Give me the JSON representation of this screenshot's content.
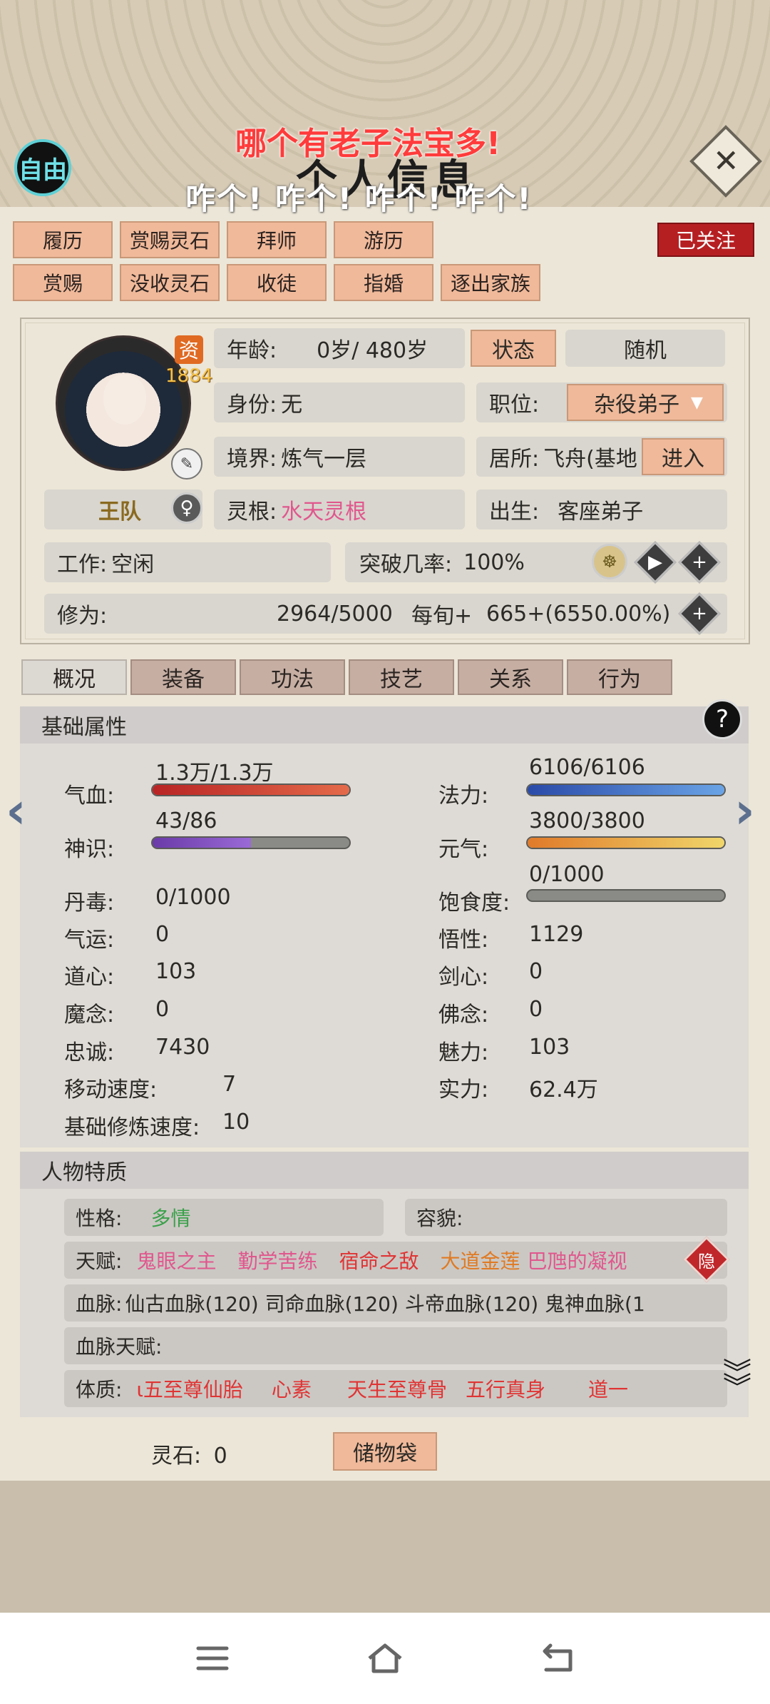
{
  "header": {
    "free_badge": "自由",
    "title": "个人信息",
    "danmaku_top": "哪个有老子法宝多!",
    "danmaku_bottom": "咋个!  咋个!  咋个!  咋个!"
  },
  "follow_button": "已关注",
  "actions": [
    "履历",
    "赏赐灵石",
    "拜师",
    "游历",
    "赏赐",
    "没收灵石",
    "收徒",
    "指婚",
    "逐出家族"
  ],
  "profile": {
    "zi_label": "资",
    "zi_value": "1884",
    "name": "王队",
    "gender_icon": "♀",
    "age_label": "年龄:",
    "age_value": "0岁/ 480岁",
    "status_button": "状态",
    "random_button": "随机",
    "identity_label": "身份:",
    "identity_value": "无",
    "position_label": "职位:",
    "position_value": "杂役弟子",
    "realm_label": "境界:",
    "realm_value": "炼气一层",
    "residence_label": "居所:",
    "residence_value": "飞舟(基地",
    "enter_button": "进入",
    "root_label": "灵根:",
    "root_value": "水天灵根",
    "birth_label": "出生:",
    "birth_value": "客座弟子",
    "work_label": "工作:",
    "work_value": "空闲",
    "breakthrough_label": "突破几率:",
    "breakthrough_value": "100%",
    "cultivation_label": "修为:",
    "cultivation_value": "2964/5000",
    "per_tick_label": "每旬+",
    "per_tick_value": "665+(6550.00%)"
  },
  "tabs": [
    "概况",
    "装备",
    "功法",
    "技艺",
    "关系",
    "行为"
  ],
  "basic": {
    "section_title": "基础属性",
    "qixue_label": "气血:",
    "qixue_value": "1.3万/1.3万",
    "qixue_fill": 1.0,
    "fali_label": "法力:",
    "fali_value": "6106/6106",
    "fali_fill": 1.0,
    "shenshi_label": "神识:",
    "shenshi_value": "43/86",
    "shenshi_fill": 0.5,
    "yuanqi_label": "元气:",
    "yuanqi_value": "3800/3800",
    "yuanqi_fill": 1.0,
    "baoshi_label": "饱食度:",
    "baoshi_value": "0/1000",
    "baoshi_fill": 0.0,
    "rows": [
      {
        "l_label": "丹毒:",
        "l_value": "0/1000",
        "r_label": "",
        "r_value": ""
      },
      {
        "l_label": "气运:",
        "l_value": "0",
        "r_label": "悟性:",
        "r_value": "1129"
      },
      {
        "l_label": "道心:",
        "l_value": "103",
        "r_label": "剑心:",
        "r_value": "0"
      },
      {
        "l_label": "魔念:",
        "l_value": "0",
        "r_label": "佛念:",
        "r_value": "0"
      },
      {
        "l_label": "忠诚:",
        "l_value": "7430",
        "r_label": "魅力:",
        "r_value": "103"
      },
      {
        "l_label": "移动速度:",
        "l_value": "7",
        "r_label": "实力:",
        "r_value": "62.4万"
      },
      {
        "l_label": "基础修炼速度:",
        "l_value": "10",
        "r_label": "",
        "r_value": ""
      }
    ]
  },
  "traits": {
    "section_title": "人物特质",
    "personality_label": "性格:",
    "personality_value": "多情",
    "appearance_label": "容貌:",
    "talent_label": "天赋:",
    "talents": [
      "鬼眼之主",
      "勤学苦练",
      "宿命之敌",
      "大道金莲",
      "巴虺的凝视"
    ],
    "hide_badge": "隐",
    "bloodline_label": "血脉:",
    "bloodline_value": "仙古血脉(120)  司命血脉(120)  斗帝血脉(120)  鬼神血脉(1",
    "bloodline_talent_label": "血脉天赋:",
    "physique_label": "体质:",
    "physiques": [
      "ι五至尊仙胎",
      "心素",
      "天生至尊骨",
      "五行真身",
      "道一"
    ]
  },
  "footer": {
    "stone_label": "灵石:",
    "stone_value": "0",
    "bag_button": "储物袋"
  },
  "icons": {
    "close": "close-icon",
    "help": "help-icon",
    "left_arrow": "chevron-left-icon",
    "right_arrow": "chevron-right-icon",
    "chevrons": "double-chevron-down-icon",
    "menu": "menu-icon",
    "home": "home-icon",
    "back": "back-icon"
  }
}
